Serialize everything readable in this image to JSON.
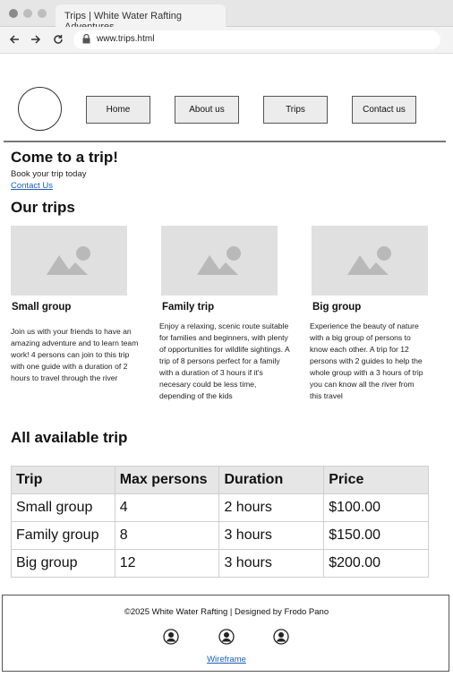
{
  "browser": {
    "tab_title": "Trips | White Water Rafting Adventures",
    "url": "www.trips.html"
  },
  "nav": {
    "items": [
      {
        "label": "Home"
      },
      {
        "label": "About us"
      },
      {
        "label": "Trips"
      },
      {
        "label": "Contact us"
      }
    ]
  },
  "hero": {
    "heading": "Come to a trip!",
    "subtext": "Book your trip today",
    "contact_link": "Contact Us"
  },
  "trips_section": {
    "heading": "Our trips",
    "cards": [
      {
        "title": "Small group",
        "description": "Join us with your friends to have an amazing adventure and to learn team work! 4 persons can join to this trip with one guide with a duration of 2 hours to travel through the river"
      },
      {
        "title": "Family trip",
        "description": "Enjoy a relaxing, scenic route suitable for families and beginners, with plenty of opportunities for wildlife sightings. A trip of 8 persons perfect for a family with a duration of 3 hours if it's necesary could be less time, depending of the kids"
      },
      {
        "title": "Big group",
        "description": "Experience the beauty of nature with a big group of persons to know each other. A trip for 12 persons with 2 guides to help the whole group with a 3 hours of trip you can know all the river from this travel"
      }
    ]
  },
  "table_section": {
    "heading": "All available trip",
    "columns": [
      "Trip",
      "Max persons",
      "Duration",
      "Price"
    ],
    "rows": [
      [
        "Small group",
        "4",
        "2 hours",
        "$100.00"
      ],
      [
        "Family group",
        "8",
        "3 hours",
        "$150.00"
      ],
      [
        "Big group",
        "12",
        "3 hours",
        "$200.00"
      ]
    ]
  },
  "footer": {
    "text": "©2025 White Water Rafting | Designed by Frodo Pano",
    "social_icons": [
      "person-icon",
      "person-icon",
      "person-icon"
    ],
    "link": "Wireframe"
  }
}
